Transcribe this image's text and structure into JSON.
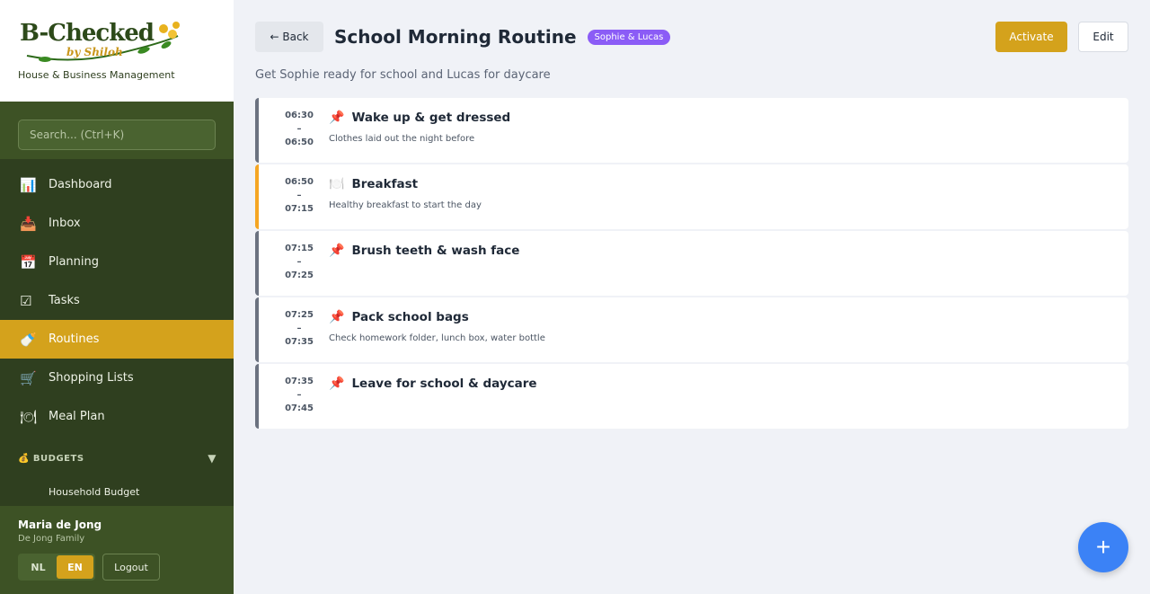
{
  "brand": {
    "logo_text": "B-Checked",
    "logo_sub": "by Shiloh",
    "tagline": "House & Business Management"
  },
  "search": {
    "placeholder": "Search... (Ctrl+K)"
  },
  "nav": [
    {
      "label": "Dashboard",
      "icon": "chart-icon",
      "glyph": "📊"
    },
    {
      "label": "Inbox",
      "icon": "inbox-icon",
      "glyph": "📥"
    },
    {
      "label": "Planning",
      "icon": "calendar-icon",
      "glyph": "📅"
    },
    {
      "label": "Tasks",
      "icon": "checkbox-icon",
      "glyph": "☑"
    },
    {
      "label": "Routines",
      "icon": "bottle-icon",
      "glyph": "🍼"
    },
    {
      "label": "Shopping Lists",
      "icon": "cart-icon",
      "glyph": "🛒"
    },
    {
      "label": "Meal Plan",
      "icon": "plate-icon",
      "glyph": "🍽"
    }
  ],
  "budgets": {
    "heading": "💰 BUDGETS",
    "caret": "▼",
    "items": [
      "Household Budget"
    ]
  },
  "user": {
    "name": "Maria de Jong",
    "family": "De Jong Family",
    "lang_nl": "NL",
    "lang_en": "EN",
    "logout": "Logout"
  },
  "header": {
    "back": "← Back",
    "title": "School Morning Routine",
    "badge": "Sophie & Lucas",
    "activate": "Activate",
    "edit": "Edit"
  },
  "description": "Get Sophie ready for school and Lucas for daycare",
  "steps": [
    {
      "start": "06:30",
      "sep": "–",
      "end": "06:50",
      "icon": "📌",
      "title": "Wake up & get dressed",
      "note": "Clothes laid out the night before"
    },
    {
      "start": "06:50",
      "sep": "–",
      "end": "07:15",
      "icon": "🍽️",
      "title": "Breakfast",
      "note": "Healthy breakfast to start the day"
    },
    {
      "start": "07:15",
      "sep": "–",
      "end": "07:25",
      "icon": "📌",
      "title": "Brush teeth & wash face",
      "note": ""
    },
    {
      "start": "07:25",
      "sep": "–",
      "end": "07:35",
      "icon": "📌",
      "title": "Pack school bags",
      "note": "Check homework folder, lunch box, water bottle"
    },
    {
      "start": "07:35",
      "sep": "–",
      "end": "07:45",
      "icon": "📌",
      "title": "Leave for school & daycare",
      "note": ""
    }
  ],
  "fab": "+",
  "colors": {
    "sidebar": "#2f3f1f",
    "accent": "#d4a21c",
    "badge": "#8b5cf6",
    "fab": "#3b82f6",
    "breakfast_border": "#f5a623"
  }
}
